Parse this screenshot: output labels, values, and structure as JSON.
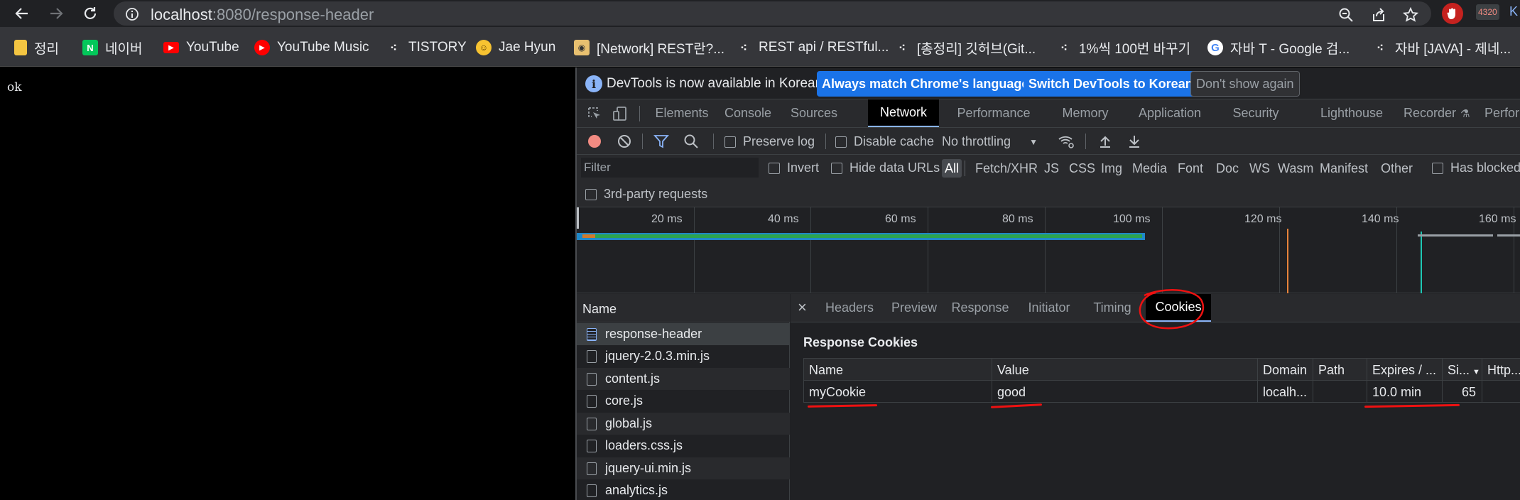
{
  "browser": {
    "url_host": "localhost",
    "url_path": ":8080/response-header",
    "ext_badge": "4320"
  },
  "bookmarks": [
    {
      "label": "정리",
      "icon": "folder-icon",
      "color": "#f4c542"
    },
    {
      "label": "네이버",
      "icon": "naver-icon",
      "color": "#03c75a"
    },
    {
      "label": "YouTube",
      "icon": "youtube-icon",
      "color": "#ff0000"
    },
    {
      "label": "YouTube Music",
      "icon": "youtube-music-icon",
      "color": "#ff0000"
    },
    {
      "label": "TISTORY",
      "icon": "tistory-icon",
      "color": "#ffffff"
    },
    {
      "label": "Jae Hyun",
      "icon": "emoji-icon",
      "color": "#f7c331"
    },
    {
      "label": "[Network] REST란?...",
      "icon": "avatar-icon",
      "color": "#e8c070"
    },
    {
      "label": "REST api / RESTful...",
      "icon": "tistory-icon",
      "color": "#ffffff"
    },
    {
      "label": "[총정리] 깃허브(Git...",
      "icon": "tistory-icon",
      "color": "#ffffff"
    },
    {
      "label": "1%씩 100번 바꾸기",
      "icon": "tistory-icon",
      "color": "#ffffff"
    },
    {
      "label": "자바 T - Google 검...",
      "icon": "google-icon",
      "color": "#4285f4"
    },
    {
      "label": "자바 [JAVA] - 제네...",
      "icon": "tistory-icon",
      "color": "#ffffff"
    }
  ],
  "page": {
    "text": "ok"
  },
  "devtools": {
    "infobar": {
      "message": "DevTools is now available in Korean!",
      "btn_match": "Always match Chrome's language",
      "btn_switch": "Switch DevTools to Korean",
      "btn_dismiss": "Don't show again"
    },
    "tabs": [
      "Elements",
      "Console",
      "Sources",
      "Network",
      "Performance",
      "Memory",
      "Application",
      "Security",
      "Lighthouse",
      "Recorder",
      "Perform"
    ],
    "active_tab": "Network",
    "network_toolbar": {
      "preserve_log": "Preserve log",
      "disable_cache": "Disable cache",
      "throttling": "No throttling"
    },
    "filter": {
      "placeholder": "Filter",
      "invert": "Invert",
      "hide_data_urls": "Hide data URLs",
      "types": [
        "All",
        "Fetch/XHR",
        "JS",
        "CSS",
        "Img",
        "Media",
        "Font",
        "Doc",
        "WS",
        "Wasm",
        "Manifest",
        "Other"
      ],
      "has_blocked": "Has blocked",
      "third_party": "3rd-party requests"
    },
    "timeline_ticks": [
      "20 ms",
      "40 ms",
      "60 ms",
      "80 ms",
      "100 ms",
      "120 ms",
      "140 ms",
      "160 ms"
    ],
    "name_header": "Name",
    "requests": [
      "response-header",
      "jquery-2.0.3.min.js",
      "content.js",
      "core.js",
      "global.js",
      "loaders.css.js",
      "jquery-ui.min.js",
      "analytics.js"
    ],
    "detail_tabs": [
      "Headers",
      "Preview",
      "Response",
      "Initiator",
      "Timing",
      "Cookies"
    ],
    "active_detail_tab": "Cookies",
    "response_cookies": {
      "title": "Response Cookies",
      "columns": [
        "Name",
        "Value",
        "Domain",
        "Path",
        "Expires / ...",
        "Si...",
        "Http..."
      ],
      "rows": [
        [
          "myCookie",
          "good",
          "localh...",
          "",
          "10.0 min",
          "65",
          ""
        ]
      ]
    }
  }
}
